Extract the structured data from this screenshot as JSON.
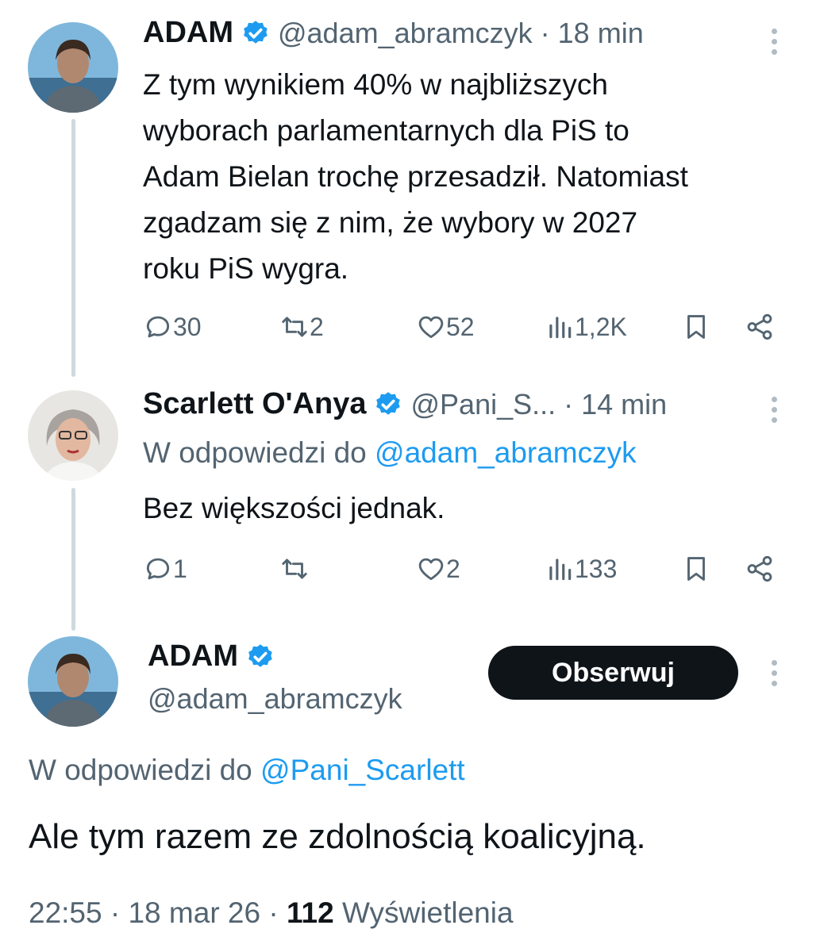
{
  "tweets": [
    {
      "name": "ADAM",
      "handle": "@adam_abramczyk",
      "time_sep": "·",
      "time": "18 min",
      "text_lines": [
        "Z tym wynikiem 40% w najbliższych",
        "wyborach parlamentarnych dla PiS to",
        "Adam Bielan trochę przesadził. Natomiast",
        "zgadzam się z nim, że wybory w 2027",
        "roku PiS wygra."
      ],
      "replies": "30",
      "retweets": "2",
      "likes": "52",
      "views": "1,2K"
    },
    {
      "name": "Scarlett O'Anya",
      "handle": "@Pani_S...",
      "time_sep": "·",
      "time": "14 min",
      "reply_prefix": "W odpowiedzi do",
      "reply_to": "@adam_abramczyk",
      "text": "Bez większości jednak.",
      "replies": "1",
      "retweets": "",
      "likes": "2",
      "views": "133"
    }
  ],
  "main": {
    "name": "ADAM",
    "handle": "@adam_abramczyk",
    "follow_label": "Obserwuj",
    "reply_prefix": "W odpowiedzi do",
    "reply_to": "@Pani_Scarlett",
    "text": "Ale tym razem ze zdolnością koalicyjną.",
    "time": "22:55",
    "date": "18 mar 26",
    "sep": "·",
    "views_count": "112",
    "views_label": "Wyświetlenia"
  },
  "colors": {
    "accent": "#1d9bf0",
    "secondary_text": "#536471",
    "thread_line": "#cfd9de",
    "button_bg": "#0f1419"
  }
}
